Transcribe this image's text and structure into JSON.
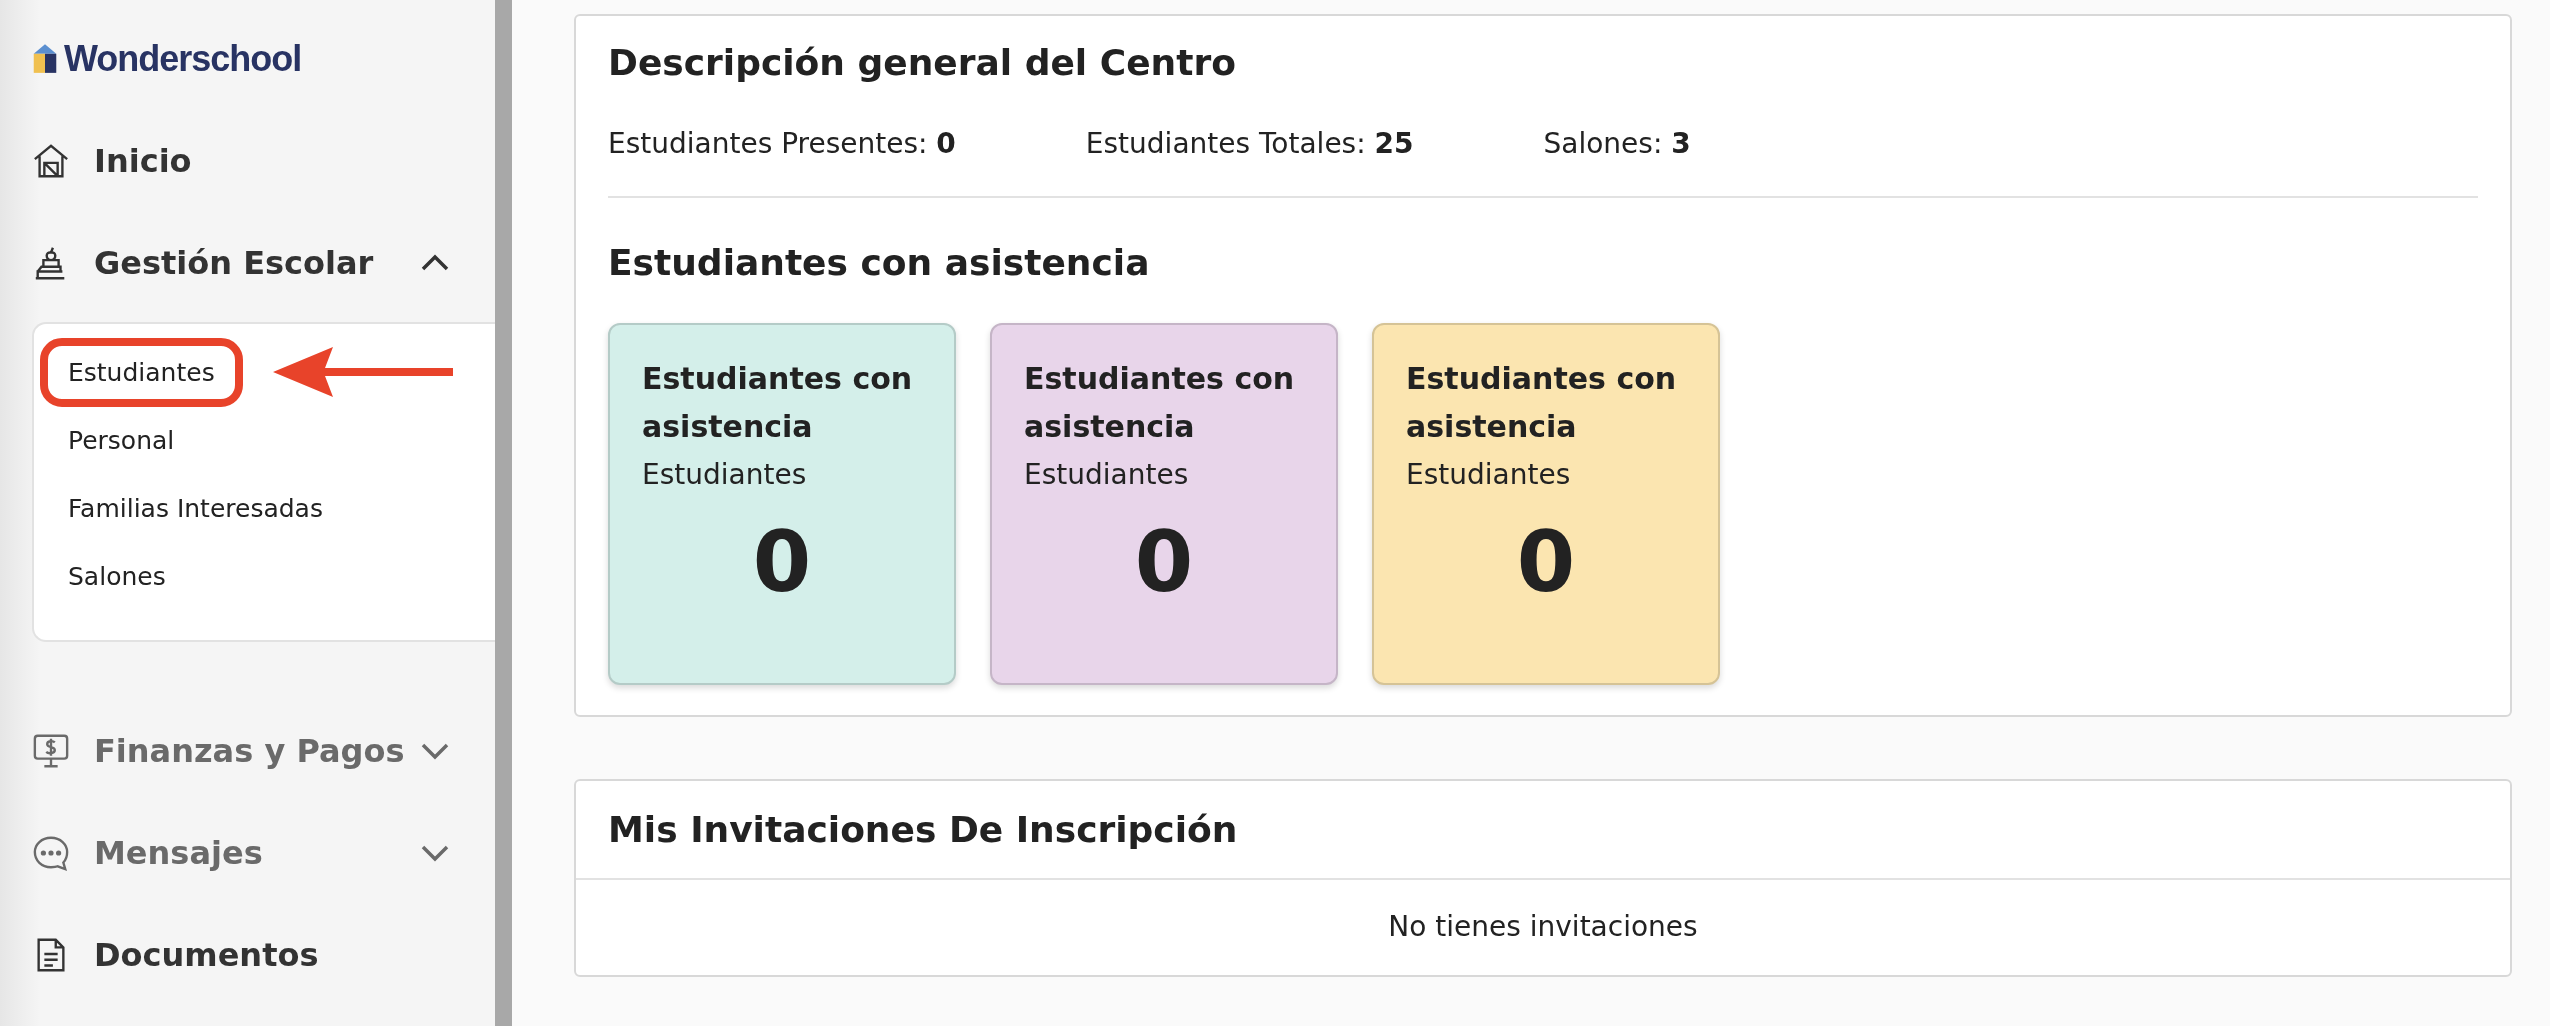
{
  "sidebar": {
    "logo": "Wonderschool",
    "items": [
      {
        "label": "Inicio",
        "dimmed": false
      },
      {
        "label": "Gestión Escolar",
        "dimmed": false,
        "expanded": true,
        "children": [
          {
            "label": "Estudiantes",
            "highlighted": true
          },
          {
            "label": "Personal",
            "highlighted": false
          },
          {
            "label": "Familias Interesadas",
            "highlighted": false
          },
          {
            "label": "Salones",
            "highlighted": false
          }
        ]
      },
      {
        "label": "Finanzas y Pagos",
        "dimmed": true,
        "expanded": false
      },
      {
        "label": "Mensajes",
        "dimmed": true,
        "expanded": false
      },
      {
        "label": "Documentos",
        "dimmed": false
      }
    ]
  },
  "overview": {
    "title": "Descripción general del Centro",
    "stats": [
      {
        "label": "Estudiantes Presentes:",
        "value": "0"
      },
      {
        "label": "Estudiantes Totales:",
        "value": "25"
      },
      {
        "label": "Salones:",
        "value": "3"
      }
    ],
    "subtitle": "Estudiantes con asistencia",
    "cards": [
      {
        "title": "Estudiantes con asistencia",
        "subtitle": "Estudiantes",
        "count": "0",
        "color": "#d4efea"
      },
      {
        "title": "Estudiantes con asistencia",
        "subtitle": "Estudiantes",
        "count": "0",
        "color": "#e8d5ea"
      },
      {
        "title": "Estudiantes con asistencia",
        "subtitle": "Estudiantes",
        "count": "0",
        "color": "#fbe5b0"
      }
    ]
  },
  "invitations": {
    "title": "Mis Invitaciones De Inscripción",
    "empty": "No tienes invitaciones"
  }
}
